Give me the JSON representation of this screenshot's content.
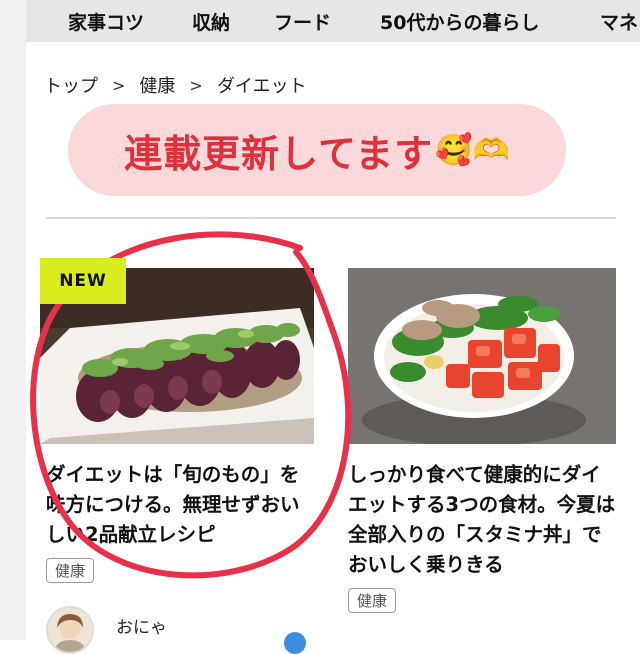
{
  "nav": {
    "items": [
      "家事コツ",
      "収納",
      "フード",
      "50代からの暮らし",
      "マネ"
    ]
  },
  "breadcrumb": {
    "items": [
      "トップ",
      "健康",
      "ダイエット"
    ],
    "separator": ">"
  },
  "banner": {
    "text": "連載更新してます",
    "emoji": "🥰🫶"
  },
  "cards": [
    {
      "badge": "NEW",
      "title": "ダイエットは「旬のもの」を味方につける。無理せずおいしい2品献立レシピ",
      "tag": "健康"
    },
    {
      "title": "しっかり食べて健康的にダイエットする3つの食材。今夏は全部入りの「スタミナ丼」でおいしく乗りきる",
      "tag": "健康"
    }
  ],
  "author": {
    "name": "おにゃ"
  },
  "colors": {
    "banner_bg": "#fbd9db",
    "banner_text": "#e0303a",
    "new_badge": "#d9ec1e",
    "annotation_circle": "#e83048",
    "nav_bg": "#e6e6e6"
  }
}
